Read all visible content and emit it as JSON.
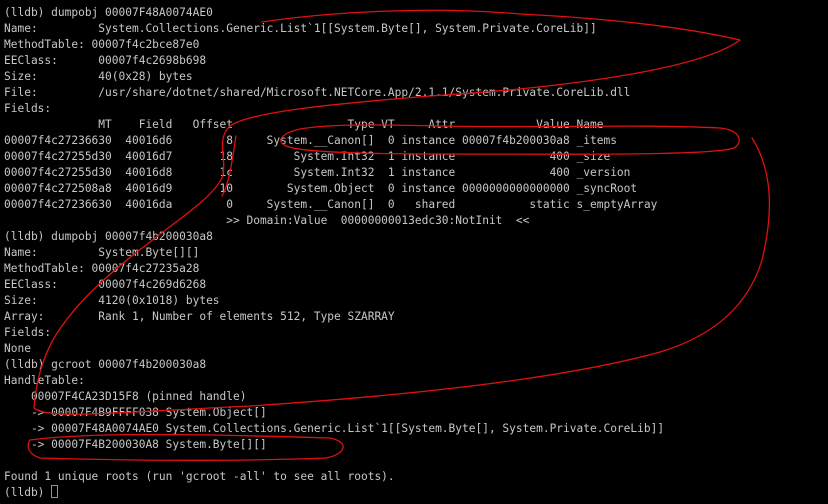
{
  "terminal": {
    "lines": [
      "    ~~~~",
      "(lldb) dumpobj 00007F48A0074AE0",
      "Name:         System.Collections.Generic.List`1[[System.Byte[], System.Private.CoreLib]]",
      "MethodTable: 00007f4c2bce87e0",
      "EEClass:      00007f4c2698b698",
      "Size:         40(0x28) bytes",
      "File:         /usr/share/dotnet/shared/Microsoft.NETCore.App/2.1.1/System.Private.CoreLib.dll",
      "Fields:",
      "              MT    Field   Offset                 Type VT     Attr            Value Name",
      "00007f4c27236630  40016d6        8     System.__Canon[]  0 instance 00007f4b200030a8 _items",
      "00007f4c27255d30  40016d7       18         System.Int32  1 instance              400 _size",
      "00007f4c27255d30  40016d8       1c         System.Int32  1 instance              400 _version",
      "00007f4c272508a8  40016d9       10        System.Object  0 instance 0000000000000000 _syncRoot",
      "00007f4c27236630  40016da        0     System.__Canon[]  0   shared           static s_emptyArray",
      "                                 >> Domain:Value  00000000013edc30:NotInit  <<",
      "(lldb) dumpobj 00007f4b200030a8",
      "Name:         System.Byte[][]",
      "MethodTable: 00007f4c27235a28",
      "EEClass:      00007f4c269d6268",
      "Size:         4120(0x1018) bytes",
      "Array:        Rank 1, Number of elements 512, Type SZARRAY",
      "Fields:",
      "None",
      "(lldb) gcroot 00007f4b200030a8",
      "HandleTable:",
      "    00007F4CA23D15F8 (pinned handle)",
      "    -> 00007F4B9FFFF038 System.Object[]",
      "    -> 00007F48A0074AE0 System.Collections.Generic.List`1[[System.Byte[], System.Private.CoreLib]]",
      "    -> 00007F4B200030A8 System.Byte[][]",
      "",
      "Found 1 unique roots (run 'gcroot -all' to see all roots).",
      "(lldb) "
    ]
  },
  "colors": {
    "background": "#000000",
    "text": "#c7c7c7",
    "cursor": "#2fd62f",
    "annotation": "#e01010"
  }
}
